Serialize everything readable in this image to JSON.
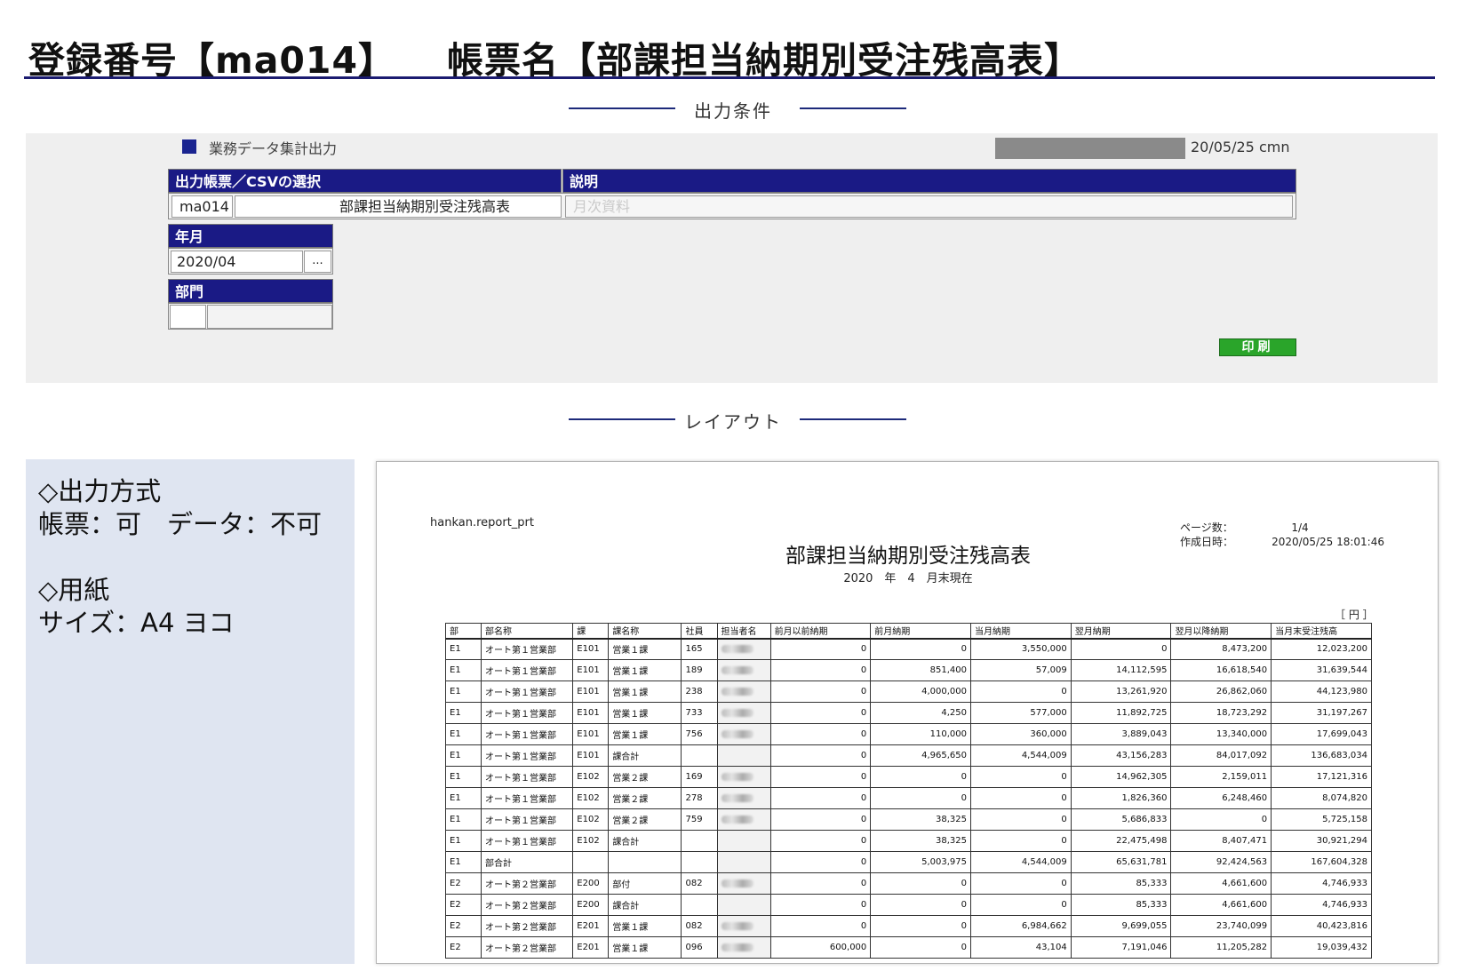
{
  "header": {
    "reg_label": "登録番号【ma014】",
    "form_label": "帳票名【部課担当納期別受注残高表】"
  },
  "sections": {
    "conditions": "出力条件",
    "layout": "レイアウト"
  },
  "conditions": {
    "heading": "業務データ集計出力",
    "date_user": "20/05/25 cmn",
    "select_header": "出力帳票／CSVの選択",
    "desc_header": "説明",
    "report_code": "ma014",
    "report_name": "部課担当納期別受注残高表",
    "desc_value": "月次資料",
    "yearmonth_header": "年月",
    "yearmonth_value": "2020/04",
    "ellipsis": "...",
    "dept_header": "部門",
    "dept_code": "",
    "dept_name": "",
    "print_label": "印刷"
  },
  "info": {
    "output_method_title": "◇出力方式",
    "output_method_value": "帳票：可　データ：不可",
    "paper_title": "◇用紙",
    "paper_value": "サイズ：A4 ヨコ"
  },
  "preview": {
    "program": "hankan.report_prt",
    "title": "部課担当納期別受注残高表",
    "subtitle": "2020　年　4　月末現在",
    "pages_label": "ページ数：",
    "pages_value": "1/4",
    "created_label": "作成日時：",
    "created_value": "2020/05/25 18:01:46",
    "unit": "［ 円 ］",
    "columns": [
      "部",
      "部名称",
      "課",
      "課名称",
      "社員",
      "担当者名",
      "前月以前納期",
      "前月納期",
      "当月納期",
      "翌月納期",
      "翌月以降納期",
      "当月末受注残高"
    ],
    "rows": [
      [
        "E1",
        "オート第１営業部",
        "E101",
        "営業１課",
        "165",
        "",
        "0",
        "0",
        "3,550,000",
        "0",
        "8,473,200",
        "12,023,200"
      ],
      [
        "E1",
        "オート第１営業部",
        "E101",
        "営業１課",
        "189",
        "",
        "0",
        "851,400",
        "57,009",
        "14,112,595",
        "16,618,540",
        "31,639,544"
      ],
      [
        "E1",
        "オート第１営業部",
        "E101",
        "営業１課",
        "238",
        "",
        "0",
        "4,000,000",
        "0",
        "13,261,920",
        "26,862,060",
        "44,123,980"
      ],
      [
        "E1",
        "オート第１営業部",
        "E101",
        "営業１課",
        "733",
        "",
        "0",
        "4,250",
        "577,000",
        "11,892,725",
        "18,723,292",
        "31,197,267"
      ],
      [
        "E1",
        "オート第１営業部",
        "E101",
        "営業１課",
        "756",
        "",
        "0",
        "110,000",
        "360,000",
        "3,889,043",
        "13,340,000",
        "17,699,043"
      ],
      [
        "E1",
        "オート第１営業部",
        "E101",
        "課合計",
        "",
        "",
        "0",
        "4,965,650",
        "4,544,009",
        "43,156,283",
        "84,017,092",
        "136,683,034"
      ],
      [
        "E1",
        "オート第１営業部",
        "E102",
        "営業２課",
        "169",
        "",
        "0",
        "0",
        "0",
        "14,962,305",
        "2,159,011",
        "17,121,316"
      ],
      [
        "E1",
        "オート第１営業部",
        "E102",
        "営業２課",
        "278",
        "",
        "0",
        "0",
        "0",
        "1,826,360",
        "6,248,460",
        "8,074,820"
      ],
      [
        "E1",
        "オート第１営業部",
        "E102",
        "営業２課",
        "759",
        "",
        "0",
        "38,325",
        "0",
        "5,686,833",
        "0",
        "5,725,158"
      ],
      [
        "E1",
        "オート第１営業部",
        "E102",
        "課合計",
        "",
        "",
        "0",
        "38,325",
        "0",
        "22,475,498",
        "8,407,471",
        "30,921,294"
      ],
      [
        "E1",
        "部合計",
        "",
        "",
        "",
        "",
        "0",
        "5,003,975",
        "4,544,009",
        "65,631,781",
        "92,424,563",
        "167,604,328"
      ],
      [
        "E2",
        "オート第２営業部",
        "E200",
        "部付",
        "082",
        "",
        "0",
        "0",
        "0",
        "85,333",
        "4,661,600",
        "4,746,933"
      ],
      [
        "E2",
        "オート第２営業部",
        "E200",
        "課合計",
        "",
        "",
        "0",
        "0",
        "0",
        "85,333",
        "4,661,600",
        "4,746,933"
      ],
      [
        "E2",
        "オート第２営業部",
        "E201",
        "営業１課",
        "082",
        "",
        "0",
        "0",
        "6,984,662",
        "9,699,055",
        "23,740,099",
        "40,423,816"
      ],
      [
        "E2",
        "オート第２営業部",
        "E201",
        "営業１課",
        "096",
        "",
        "600,000",
        "0",
        "43,104",
        "7,191,046",
        "11,205,282",
        "19,039,432"
      ]
    ]
  },
  "colors": {
    "navy": "#1a1a85",
    "print_green": "#2aa52a",
    "info_bg": "#dfe5f1",
    "panel_bg": "#efefef"
  }
}
